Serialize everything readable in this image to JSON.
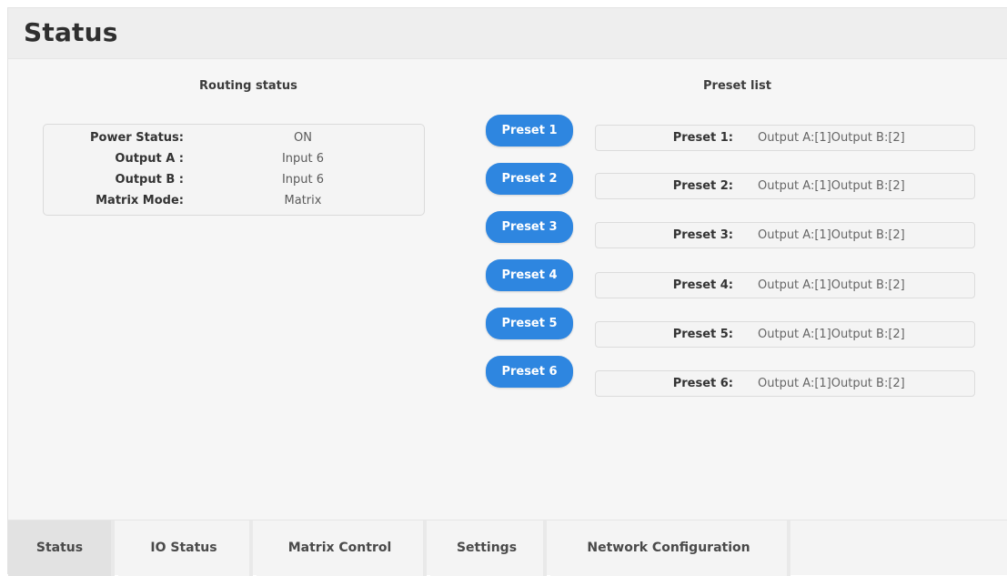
{
  "header": {
    "title": "Status"
  },
  "routing": {
    "title": "Routing status",
    "rows": [
      {
        "label": "Power Status:",
        "value": "ON"
      },
      {
        "label": "Output A :",
        "value": "Input 6"
      },
      {
        "label": "Output B :",
        "value": "Input 6"
      },
      {
        "label": "Matrix Mode:",
        "value": "Matrix"
      }
    ]
  },
  "presets": {
    "title": "Preset list",
    "items": [
      {
        "button": "Preset 1",
        "label": "Preset 1:",
        "value": "Output A:[1]Output B:[2]"
      },
      {
        "button": "Preset 2",
        "label": "Preset 2:",
        "value": "Output A:[1]Output B:[2]"
      },
      {
        "button": "Preset 3",
        "label": "Preset 3:",
        "value": "Output A:[1]Output B:[2]"
      },
      {
        "button": "Preset 4",
        "label": "Preset 4:",
        "value": "Output A:[1]Output B:[2]"
      },
      {
        "button": "Preset 5",
        "label": "Preset 5:",
        "value": "Output A:[1]Output B:[2]"
      },
      {
        "button": "Preset 6",
        "label": "Preset 6:",
        "value": "Output A:[1]Output B:[2]"
      }
    ]
  },
  "tabs": [
    {
      "label": "Status",
      "active": true
    },
    {
      "label": "IO Status",
      "active": false
    },
    {
      "label": "Matrix Control",
      "active": false
    },
    {
      "label": "Settings",
      "active": false
    },
    {
      "label": "Network Configuration",
      "active": false
    }
  ],
  "colors": {
    "accent": "#2e86e0",
    "background": "#f6f6f6",
    "active_tab": "#e2e2e2"
  }
}
